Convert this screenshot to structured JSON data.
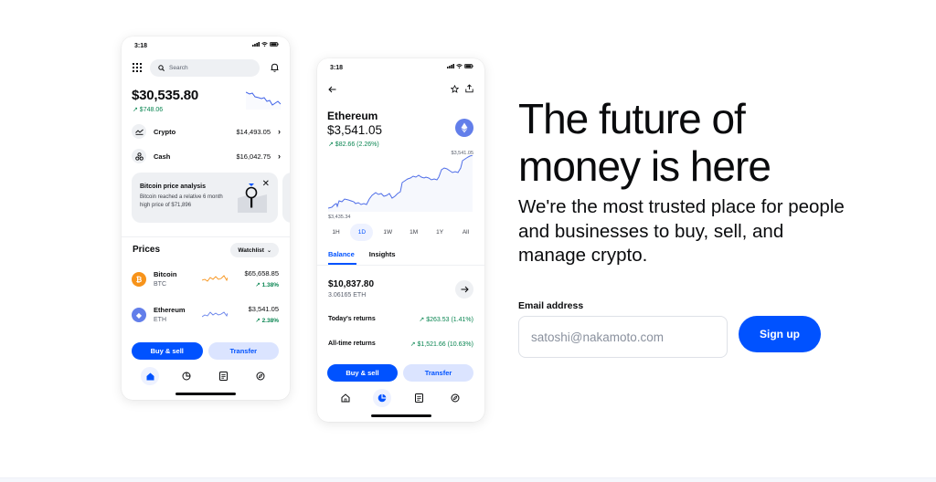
{
  "colors": {
    "brand_blue": "#0052ff",
    "positive_green": "#098551",
    "bitcoin_orange": "#f7931a",
    "ethereum_purple": "#627eea"
  },
  "phone_left": {
    "status_time": "3:18",
    "search_placeholder": "Search",
    "balance": "$30,535.80",
    "balance_change": "↗ $748.06",
    "accounts": [
      {
        "icon": "chart-line-icon",
        "label": "Crypto",
        "amount": "$14,493.05"
      },
      {
        "icon": "cash-icon",
        "label": "Cash",
        "amount": "$16,042.75"
      }
    ],
    "promo_card": {
      "title": "Bitcoin price analysis",
      "description": "Bitcoin reached a relative 6 month high price of $71,896",
      "close_glyph": "✕"
    },
    "prices_title": "Prices",
    "watchlist_label": "Watchlist",
    "assets": [
      {
        "name": "Bitcoin",
        "symbol": "BTC",
        "price": "$65,658.85",
        "change": "↗ 1.38%",
        "coin_glyph": "₿"
      },
      {
        "name": "Ethereum",
        "symbol": "ETH",
        "price": "$3,541.05",
        "change": "↗ 2.38%",
        "coin_glyph": "◆"
      }
    ],
    "buy_sell_label": "Buy & sell",
    "transfer_label": "Transfer",
    "tabs": [
      "home-icon",
      "portfolio-icon",
      "news-icon",
      "explore-icon"
    ],
    "active_tab": 0
  },
  "phone_right": {
    "status_time": "3:18",
    "asset_name": "Ethereum",
    "asset_price": "$3,541.05",
    "asset_change": "↗ $82.66 (2.26%)",
    "chart_high_label": "$3,541.05",
    "chart_low_label": "$3,435.34",
    "ranges": [
      "1H",
      "1D",
      "1W",
      "1M",
      "1Y",
      "All"
    ],
    "active_range": 1,
    "tabs": [
      "Balance",
      "Insights"
    ],
    "active_tab": 0,
    "holdings_value": "$10,837.80",
    "holdings_quantity": "3.06165 ETH",
    "returns": [
      {
        "label": "Today's returns",
        "value": "↗ $263.53 (1.41%)"
      },
      {
        "label": "All-time returns",
        "value": "↗ $1,521.66 (10.63%)"
      }
    ],
    "buy_sell_label": "Buy & sell",
    "transfer_label": "Transfer",
    "nav_tabs": [
      "home-icon",
      "portfolio-icon",
      "news-icon",
      "explore-icon"
    ],
    "active_nav_tab": 1
  },
  "hero": {
    "title_line1": "The future of",
    "title_line2": "money is here",
    "subtitle": "We're the most trusted place for people and businesses to buy, sell, and manage crypto.",
    "email_label": "Email address",
    "email_placeholder": "satoshi@nakamoto.com",
    "email_value": "",
    "signup_label": "Sign up"
  }
}
